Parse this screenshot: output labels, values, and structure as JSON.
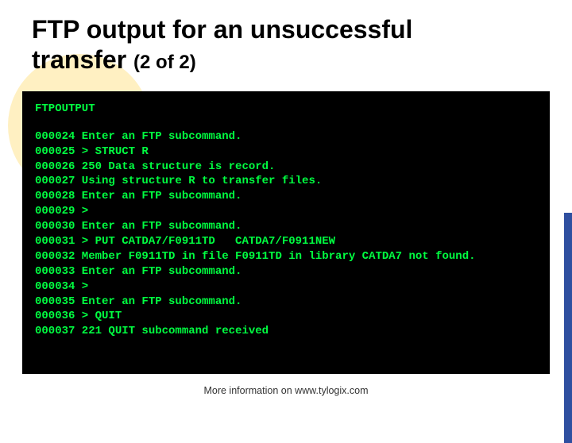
{
  "title": {
    "line1": "FTP output for an unsuccessful",
    "line2_strong": "transfer",
    "line2_sub": "(2 of 2)"
  },
  "terminal": {
    "header": "FTPOUTPUT",
    "rows": [
      {
        "num": "000024",
        "text": "Enter an FTP subcommand."
      },
      {
        "num": "000025",
        "text": "> STRUCT R"
      },
      {
        "num": "000026",
        "text": "250 Data structure is record."
      },
      {
        "num": "000027",
        "text": "Using structure R to transfer files."
      },
      {
        "num": "000028",
        "text": "Enter an FTP subcommand."
      },
      {
        "num": "000029",
        "text": ">"
      },
      {
        "num": "000030",
        "text": "Enter an FTP subcommand."
      },
      {
        "num": "000031",
        "text": "> PUT CATDA7/F0911TD   CATDA7/F0911NEW"
      },
      {
        "num": "000032",
        "text": "Member F0911TD in file F0911TD in library CATDA7 not found."
      },
      {
        "num": "000033",
        "text": "Enter an FTP subcommand."
      },
      {
        "num": "000034",
        "text": ">"
      },
      {
        "num": "000035",
        "text": "Enter an FTP subcommand."
      },
      {
        "num": "000036",
        "text": "> QUIT"
      },
      {
        "num": "000037",
        "text": "221 QUIT subcommand received"
      }
    ]
  },
  "footer": "More information on www.tylogix.com"
}
